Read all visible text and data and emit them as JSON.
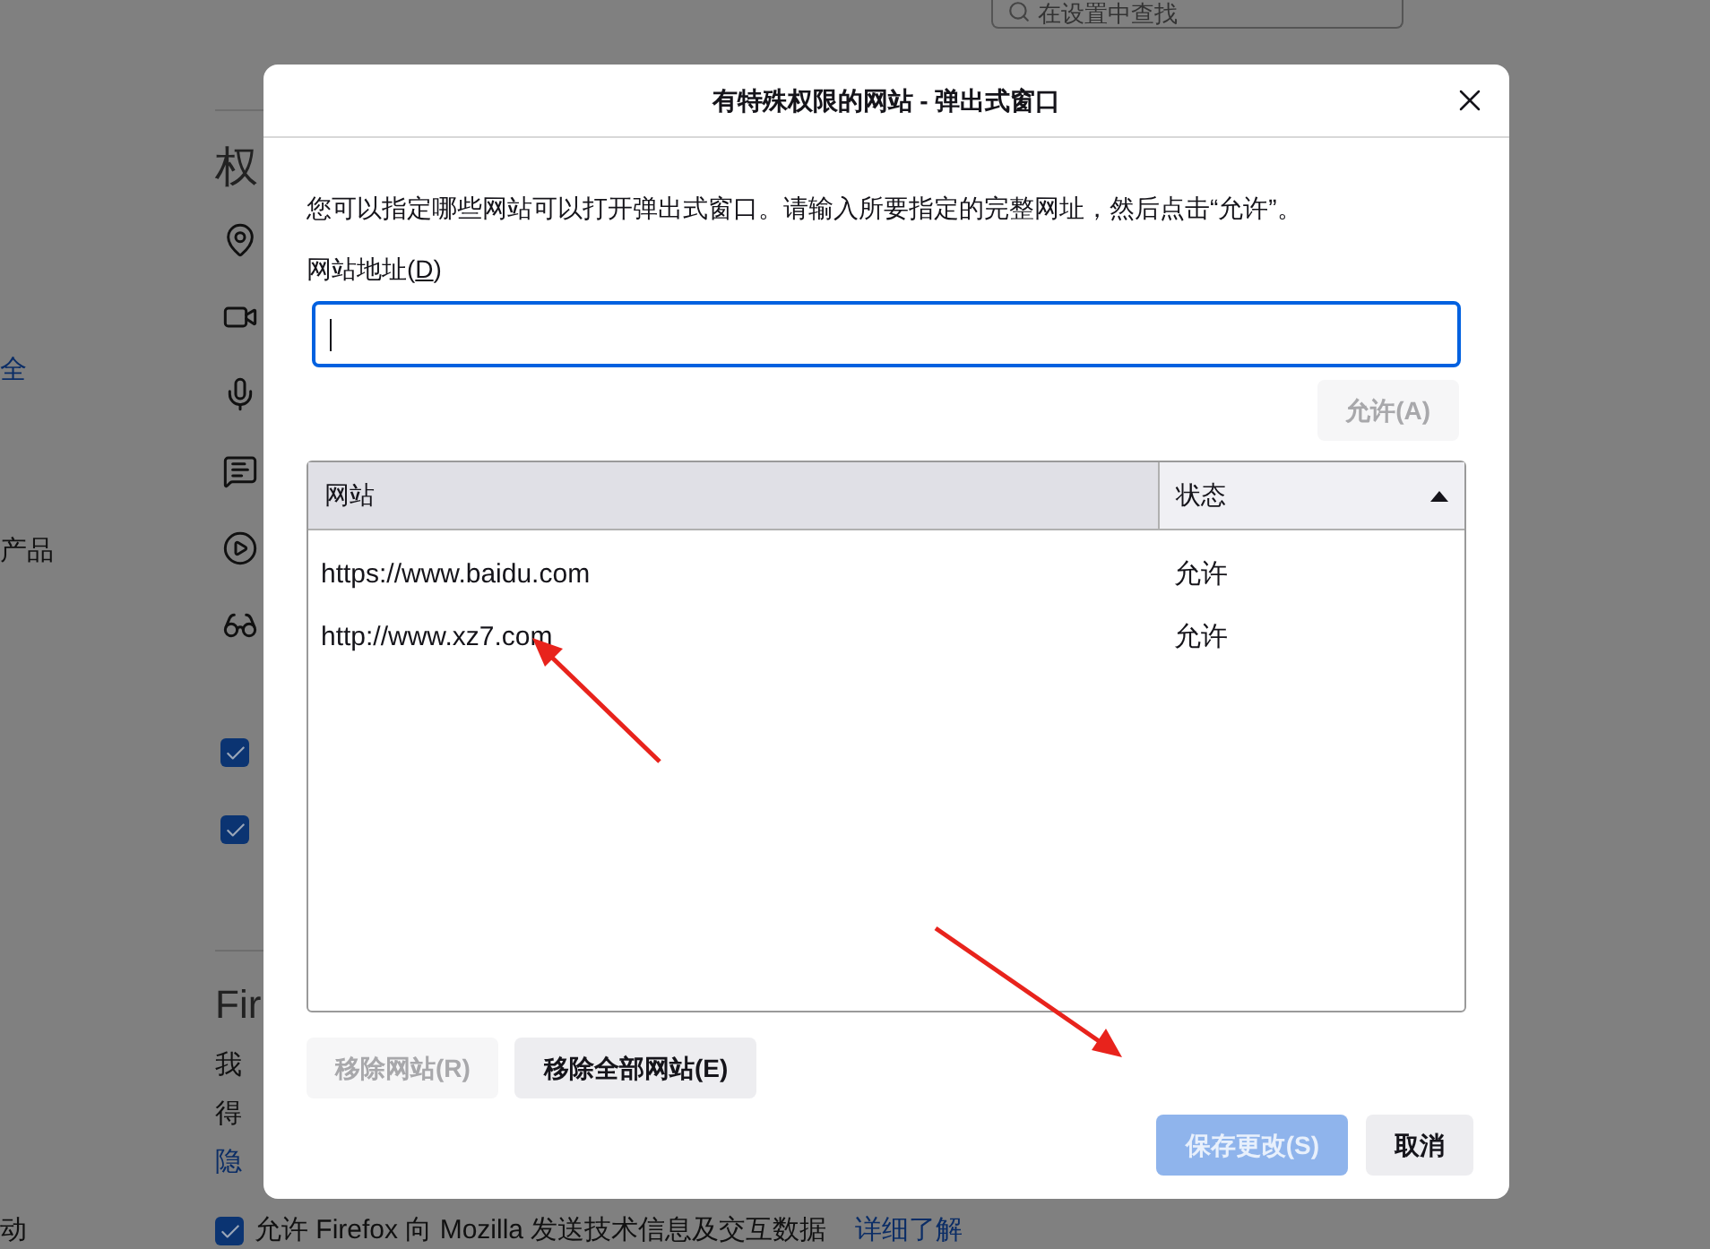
{
  "settings_page": {
    "search": {
      "placeholder": "在设置中查找"
    },
    "sidebar": [
      {
        "label": "全",
        "link": true
      },
      {
        "label": "产品",
        "link": false
      }
    ],
    "bottom_sidebar": {
      "label": "动",
      "link": false
    },
    "permissions_heading": "权",
    "checkboxes": [
      {
        "checked": true
      },
      {
        "checked": true
      }
    ],
    "firefox_heading": "Fir",
    "lines": [
      "我",
      "得"
    ],
    "privacy_link": "隐",
    "telemetry": {
      "label": "允许 Firefox 向 Mozilla 发送技术信息及交互数据",
      "checked": true,
      "link": "详细了解"
    }
  },
  "dialog": {
    "title": "有特殊权限的网站 - 弹出式窗口",
    "description": "您可以指定哪些网站可以打开弹出式窗口。请输入所要指定的完整网址，然后点击“允许”。",
    "address_label": {
      "before": "网站地址(",
      "access_key": "D",
      "after": ")"
    },
    "address_input": {
      "focused": true
    },
    "allow_button": {
      "label": "允许(A)",
      "disabled": true
    },
    "table": {
      "columns": [
        {
          "label": "网站",
          "sorted": false
        },
        {
          "label": "状态",
          "sorted": true
        }
      ],
      "rows": [
        {
          "site": "https://www.baidu.com",
          "status": "允许",
          "selected": false
        },
        {
          "site": "http://www.xz7.com",
          "status": "允许",
          "selected": false
        }
      ]
    },
    "remove_button": {
      "label": "移除网站(R)",
      "disabled": true
    },
    "remove_all_button": {
      "label": "移除全部网站(E)",
      "disabled": false
    },
    "save_button": {
      "label": "保存更改(S)",
      "disabled": true
    },
    "cancel_button": {
      "label": "取消",
      "disabled": false
    }
  }
}
